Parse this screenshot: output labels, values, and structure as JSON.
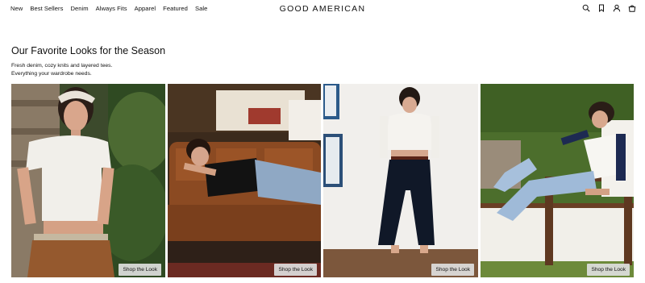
{
  "header": {
    "nav": [
      "New",
      "Best Sellers",
      "Denim",
      "Always Fits",
      "Apparel",
      "Featured",
      "Sale"
    ],
    "logo": "GOOD AMERICAN",
    "icons": [
      "search-icon",
      "bookmark-icon",
      "account-icon",
      "cart-icon"
    ]
  },
  "section": {
    "title": "Our Favorite Looks for the Season",
    "subtitle_line1": "Fresh denim, cozy knits and layered tees.",
    "subtitle_line2": "Everything your wardrobe needs."
  },
  "cards": [
    {
      "button": "Shop the Look"
    },
    {
      "button": "Shop the Look"
    },
    {
      "button": "Shop the Look"
    },
    {
      "button": "Shop the Look"
    }
  ],
  "colors": {
    "text": "#111111",
    "background": "#ffffff",
    "button_bg": "#dedede"
  }
}
